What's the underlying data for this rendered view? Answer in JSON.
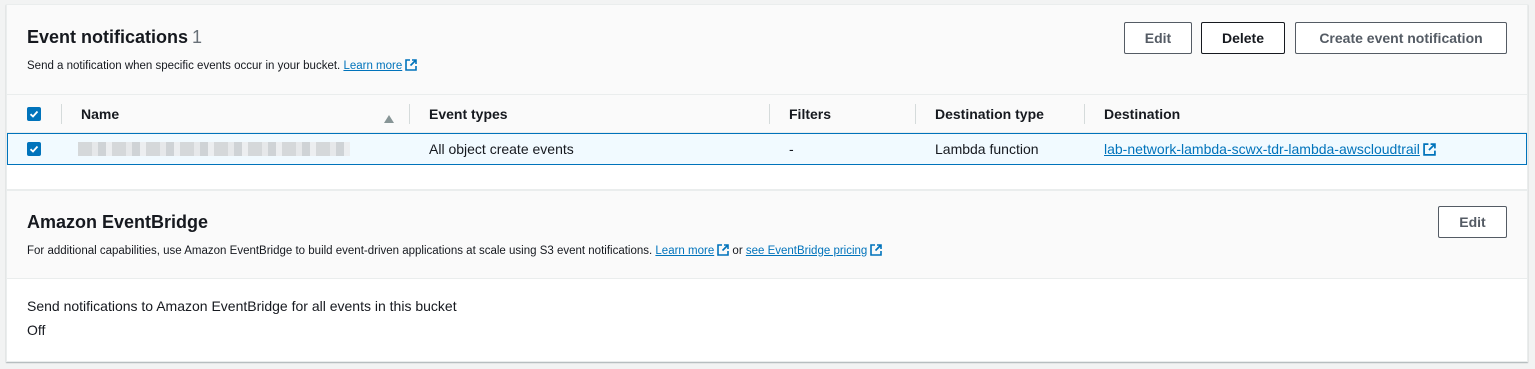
{
  "event_notifications": {
    "title": "Event notifications",
    "count": "1",
    "description": "Send a notification when specific events occur in your bucket.",
    "learn_more": "Learn more",
    "buttons": {
      "edit": "Edit",
      "delete": "Delete",
      "create": "Create event notification"
    },
    "table": {
      "columns": [
        "Name",
        "Event types",
        "Filters",
        "Destination type",
        "Destination"
      ],
      "sort_icon": "sort-ascending-icon",
      "rows": [
        {
          "selected": true,
          "name": "",
          "event_types": "All object create events",
          "filters": "-",
          "destination_type": "Lambda function",
          "destination": "lab-network-lambda-scwx-tdr-lambda-awscloudtrail"
        }
      ]
    }
  },
  "eventbridge": {
    "title": "Amazon EventBridge",
    "description_prefix": "For additional capabilities, use Amazon EventBridge to build event-driven applications at scale using S3 event notifications.",
    "learn_more": "Learn more",
    "or_text": "or",
    "pricing_link": "see EventBridge pricing",
    "edit_button": "Edit",
    "setting_label": "Send notifications to Amazon EventBridge for all events in this bucket",
    "setting_value": "Off"
  },
  "colors": {
    "accent": "#0073bb",
    "selected_row_bg": "#f1faff"
  }
}
